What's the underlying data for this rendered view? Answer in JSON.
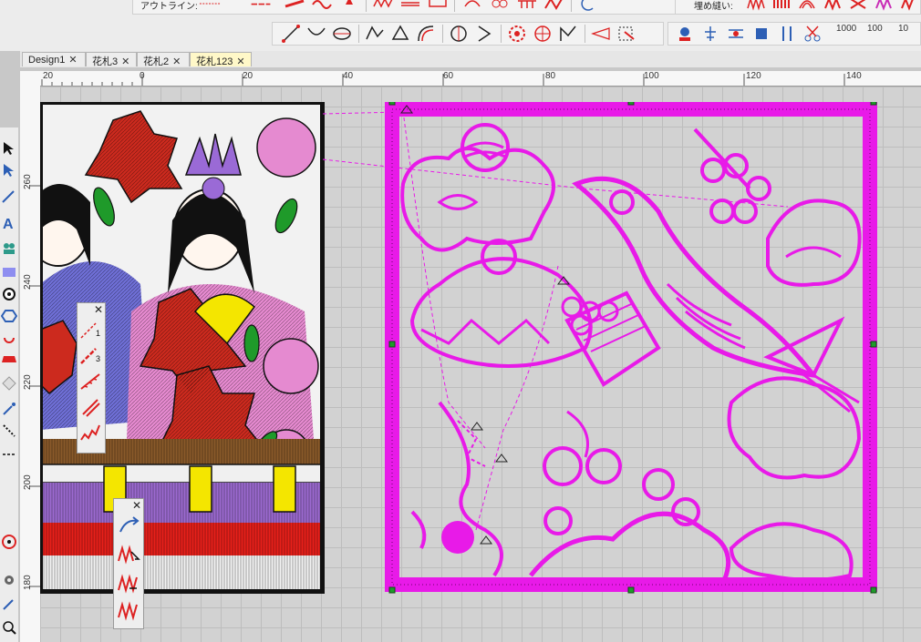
{
  "toolbar": {
    "outline_label": "アウトライン:",
    "fill_label": "埋め縫い:",
    "numbers": [
      "1000",
      "100",
      "10"
    ]
  },
  "tabs": [
    {
      "label": "Design1",
      "close": "✕"
    },
    {
      "label": "花札3",
      "close": "✕"
    },
    {
      "label": "花札2",
      "close": "✕"
    },
    {
      "label": "花札123",
      "close": "✕"
    }
  ],
  "ruler": {
    "top_labels": [
      "20",
      "0",
      "20",
      "40",
      "60",
      "80",
      "100",
      "120",
      "140"
    ],
    "left_labels": [
      "260",
      "240",
      "220",
      "200",
      "180"
    ]
  },
  "palette1": {
    "close": "✕",
    "labels": [
      "1",
      "3"
    ]
  },
  "palette2": {
    "close": "✕"
  },
  "colors": {
    "magenta": "#e81ae8",
    "red": "#cc2a1e",
    "pink": "#e58ad0",
    "purple": "#8b5bc6",
    "yellow": "#f4e600",
    "brown": "#8a5a2a",
    "green": "#1f9a2a",
    "black": "#111111"
  },
  "icons": {
    "select_tool": "arrow-select-icon",
    "node_tool": "node-select-icon"
  }
}
